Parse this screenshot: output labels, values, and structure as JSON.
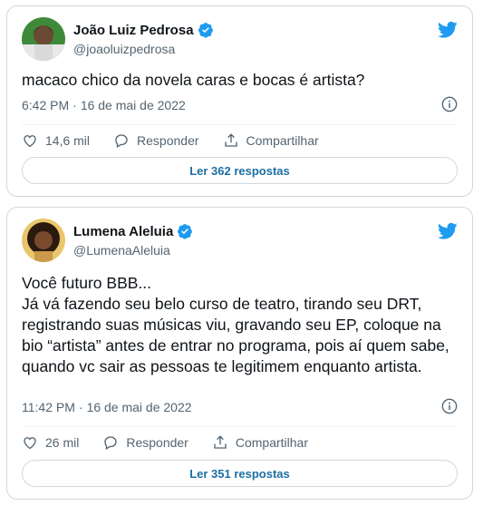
{
  "colors": {
    "accent": "#1d9bf0",
    "reply_link": "#1d6fa3",
    "muted_text": "#536471",
    "border": "#cfd9de"
  },
  "tweets": [
    {
      "display_name": "João Luiz Pedrosa",
      "handle": "@joaoluizpedrosa",
      "verified": true,
      "text": "macaco chico da novela caras e bocas é artista?",
      "time": "6:42 PM",
      "separator": "·",
      "date": "16 de mai de 2022",
      "likes": "14,6 mil",
      "reply_label": "Responder",
      "share_label": "Compartilhar",
      "read_replies": "Ler 362 respostas",
      "icons": [
        "avatar",
        "verified-badge-icon",
        "twitter-bird-icon",
        "info-icon",
        "heart-icon",
        "reply-bubble-icon",
        "share-icon"
      ]
    },
    {
      "display_name": "Lumena Aleluia",
      "handle": "@LumenaAleluia",
      "verified": true,
      "text": "Você futuro BBB...\nJá vá fazendo seu belo curso de teatro, tirando seu DRT, registrando suas músicas viu, gravando seu EP, coloque na bio “artista” antes de entrar no programa, pois aí quem sabe, quando vc sair as pessoas te legitimem enquanto artista.",
      "time": "11:42 PM",
      "separator": "·",
      "date": "16 de mai de 2022",
      "likes": "26 mil",
      "reply_label": "Responder",
      "share_label": "Compartilhar",
      "read_replies": "Ler 351 respostas",
      "icons": [
        "avatar",
        "verified-badge-icon",
        "twitter-bird-icon",
        "info-icon",
        "heart-icon",
        "reply-bubble-icon",
        "share-icon"
      ]
    }
  ]
}
